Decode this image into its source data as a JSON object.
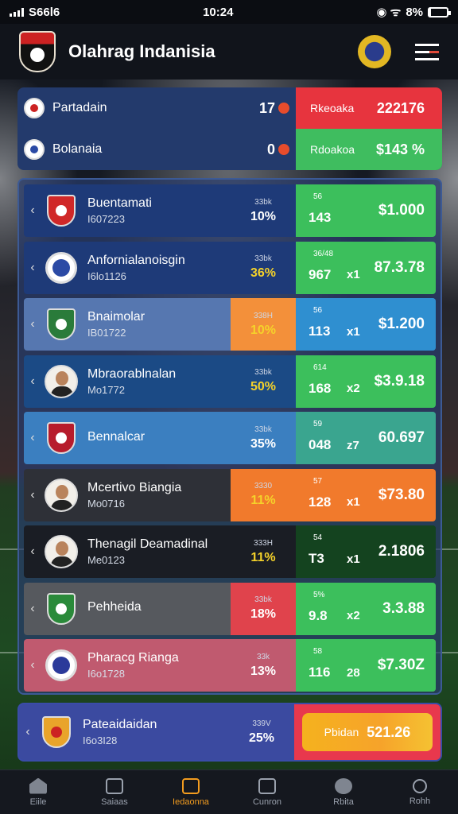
{
  "status_bar": {
    "carrier": "S66l6",
    "time": "10:24",
    "battery": "8%",
    "battery_fill": 0.08
  },
  "header": {
    "title": "Olahrag Indanisia"
  },
  "summary": [
    {
      "name": "Partadain",
      "num": "17",
      "label": "Rkeoaka",
      "value": "222176",
      "color": "#e7343e"
    },
    {
      "name": "Bolanaia",
      "num": "0",
      "label": "Rdoakoa",
      "value": "$143 %",
      "color": "#3fbd5f"
    }
  ],
  "teams": [
    {
      "name": "Buentamati",
      "sub": "I607223",
      "pct_small": "33bk",
      "pct": "10%",
      "pct_color": "#fff",
      "left_bg": "#1e3a78",
      "pct_bg": "#1e3a78",
      "badge": "crest",
      "badge_color": "#d02828",
      "stat_small": "56",
      "stat_main": "143",
      "stat_mult": "",
      "price": "$1.000",
      "right_bg": "#3cbf5c"
    },
    {
      "name": "Anfornialanoisgin",
      "sub": "I6lo1126",
      "pct_small": "33bk",
      "pct": "36%",
      "pct_color": "#f5d22a",
      "left_bg": "#1e3a78",
      "pct_bg": "#1e3a78",
      "badge": "roundel",
      "badge_color": "#2b4aa5",
      "stat_small": "36/48",
      "stat_main": "967",
      "stat_mult": "x1",
      "price": "87.3.78",
      "right_bg": "#3cbf5c"
    },
    {
      "name": "Bnaimolar",
      "sub": "IB01722",
      "pct_small": "338H",
      "pct": "10%",
      "pct_color": "#f5d22a",
      "left_bg": "#5677b0",
      "pct_bg": "#f3903a",
      "badge": "crest",
      "badge_color": "#2a7b3a",
      "stat_small": "56",
      "stat_main": "113",
      "stat_mult": "x1",
      "price": "$1.200",
      "right_bg": "#2f8fd0"
    },
    {
      "name": "Mbraorablnalan",
      "sub": "Mo1772",
      "pct_small": "33bk",
      "pct": "50%",
      "pct_color": "#f5d22a",
      "left_bg": "#1b4a85",
      "pct_bg": "#1b4a85",
      "badge": "avatar",
      "badge_color": "#222",
      "stat_small": "614",
      "stat_main": "168",
      "stat_mult": "x2",
      "price": "$3.9.18",
      "right_bg": "#3cbf5c"
    },
    {
      "name": "Bennalcar",
      "sub": "",
      "pct_small": "33bk",
      "pct": "35%",
      "pct_color": "#fff",
      "left_bg": "#3b7fc0",
      "pct_bg": "#3b7fc0",
      "badge": "crest",
      "badge_color": "#b71c2c",
      "stat_small": "59",
      "stat_main": "048",
      "stat_mult": "z7",
      "price": "60.697",
      "right_bg": "#3aa58f"
    },
    {
      "name": "Mcertivo Biangia",
      "sub": "Mo0716",
      "pct_small": "3330",
      "pct": "11%",
      "pct_color": "#f5d22a",
      "left_bg": "#2e3037",
      "pct_bg": "#f17a2c",
      "badge": "avatar",
      "badge_color": "#222",
      "stat_small": "57",
      "stat_main": "128",
      "stat_mult": "x1",
      "price": "$73.80",
      "right_bg": "#f17a2c"
    },
    {
      "name": "Thenagil Deamadinal",
      "sub": "Me0123",
      "pct_small": "333H",
      "pct": "11%",
      "pct_color": "#f5d22a",
      "left_bg": "#1a1d24",
      "pct_bg": "#1a1d24",
      "badge": "avatar",
      "badge_color": "#222",
      "stat_small": "54",
      "stat_main": "T3",
      "stat_mult": "x1",
      "price": "2.1806",
      "right_bg": "#14431f"
    },
    {
      "name": "Pehheida",
      "sub": "",
      "pct_small": "33bk",
      "pct": "18%",
      "pct_color": "#fff",
      "left_bg": "#56595e",
      "pct_bg": "#e0434c",
      "badge": "crest",
      "badge_color": "#2a8a3a",
      "stat_small": "5%",
      "stat_main": "9.8",
      "stat_mult": "x2",
      "price": "3.3.88",
      "right_bg": "#3cbf5c"
    },
    {
      "name": "Pharacg Rianga",
      "sub": "I6o1728",
      "pct_small": "33k",
      "pct": "13%",
      "pct_color": "#fff",
      "left_bg": "#c05a6f",
      "pct_bg": "#c05a6f",
      "badge": "roundel",
      "badge_color": "#2b3a9a",
      "stat_small": "58",
      "stat_main": "116",
      "stat_mult": "28",
      "price": "$7.30Z",
      "right_bg": "#3cbf5c"
    }
  ],
  "featured": {
    "name": "Pateaidaidan",
    "sub": "I6o3I28",
    "pct_small": "339V",
    "pct": "25%",
    "cta_label": "Pbidan",
    "cta_value": "521.26"
  },
  "tabs": [
    {
      "label": "Eiile",
      "icon": "home-icon"
    },
    {
      "label": "Saiaas",
      "icon": "calendar-icon"
    },
    {
      "label": "Iedaonna",
      "icon": "bet-slip-icon",
      "active": true
    },
    {
      "label": "Cunron",
      "icon": "field-icon"
    },
    {
      "label": "Rbita",
      "icon": "profile-icon"
    },
    {
      "label": "Rohh",
      "icon": "search-icon"
    }
  ]
}
